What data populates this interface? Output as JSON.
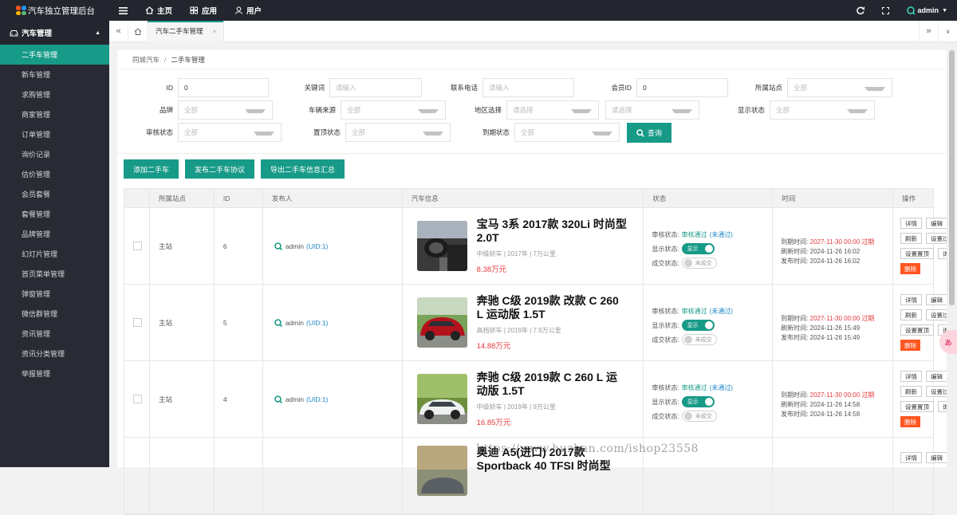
{
  "app": {
    "title": "汽车独立管理后台"
  },
  "topnav": [
    {
      "label": "主页",
      "icon": "home-icon"
    },
    {
      "label": "应用",
      "icon": "apps-icon"
    },
    {
      "label": "用户",
      "icon": "user-icon"
    }
  ],
  "user": {
    "name": "admin"
  },
  "sidebar": {
    "group": "汽车管理",
    "items": [
      {
        "label": "二手车管理"
      },
      {
        "label": "新车管理"
      },
      {
        "label": "求购管理"
      },
      {
        "label": "商家管理"
      },
      {
        "label": "订单管理"
      },
      {
        "label": "询价记录"
      },
      {
        "label": "估价管理"
      },
      {
        "label": "会员套餐"
      },
      {
        "label": "套餐管理"
      },
      {
        "label": "品牌管理"
      },
      {
        "label": "幻灯片管理"
      },
      {
        "label": "首页菜单管理"
      },
      {
        "label": "弹窗管理"
      },
      {
        "label": "微信群管理"
      },
      {
        "label": "资讯管理"
      },
      {
        "label": "资讯分类管理"
      },
      {
        "label": "举报管理"
      }
    ]
  },
  "tab": {
    "label": "汽车二手车管理",
    "close": "×"
  },
  "breadcrumb": {
    "root": "同城汽车",
    "sep": "/",
    "current": "二手车管理"
  },
  "filters": {
    "id": {
      "label": "ID",
      "value": "0"
    },
    "keyword": {
      "label": "关键词",
      "placeholder": "请输入"
    },
    "phone": {
      "label": "联系电话",
      "placeholder": "请输入"
    },
    "member": {
      "label": "会员ID",
      "value": "0"
    },
    "site": {
      "label": "所属站点",
      "value": "全部"
    },
    "brand": {
      "label": "品牌",
      "value": "全部"
    },
    "source": {
      "label": "车辆来源",
      "value": "全部"
    },
    "region": {
      "label": "地区选择",
      "value": "请选择",
      "value2": "请选择"
    },
    "display": {
      "label": "显示状态",
      "value": "全部"
    },
    "audit": {
      "label": "审核状态",
      "value": "全部"
    },
    "top": {
      "label": "置顶状态",
      "value": "全部"
    },
    "expire": {
      "label": "到期状态",
      "value": "全部"
    },
    "query_label": "查询"
  },
  "actions": {
    "add": "添加二手车",
    "agreement": "发布二手车协议",
    "export": "导出二手车信息汇总"
  },
  "table": {
    "headers": [
      "",
      "所属站点",
      "ID",
      "发布人",
      "汽车信息",
      "状态",
      "时间",
      "操作"
    ],
    "status_labels": {
      "audit": "审核状态:",
      "display": "显示状态:",
      "deal": "成交状态:",
      "passed": "审核通过",
      "reject": "(未通过)",
      "show": "显示",
      "not_deal": "未成交"
    },
    "time_labels": {
      "expire": "到期时间:",
      "refresh": "刷新时间:",
      "publish": "发布时间:"
    },
    "op_labels": {
      "detail": "详情",
      "edit": "编辑",
      "refresh": "刷新",
      "set_expire": "设置过期时间",
      "set_top": "设置置顶",
      "inquiry": "询价记录",
      "delete": "删除"
    },
    "rows": [
      {
        "site": "主站",
        "id": "6",
        "publisher": "admin",
        "uid": "(UID:1)",
        "title": "宝马 3系 2017款 320Li 时尚型 2.0T",
        "meta": "中级轿车 | 2017年 | 7万公里",
        "price": "8.38万元",
        "expire": "2027-11-30 00:00 过期",
        "refresh": "2024-11-26 16:02",
        "publish": "2024-11-26 16:02",
        "img": "interior"
      },
      {
        "site": "主站",
        "id": "5",
        "publisher": "admin",
        "uid": "(UID:1)",
        "title": "奔驰 C级 2019款 改款 C 260 L 运动版 1.5T",
        "meta": "高档轿车 | 2019年 | 7.9万公里",
        "price": "14.88万元",
        "expire": "2027-11-30 00:00 过期",
        "refresh": "2024-11-26 15:49",
        "publish": "2024-11-26 15:49",
        "img": "red"
      },
      {
        "site": "主站",
        "id": "4",
        "publisher": "admin",
        "uid": "(UID:1)",
        "title": "奔驰 C级 2019款 C 260 L 运动版 1.5T",
        "meta": "中级轿车 | 2019年 | 9万公里",
        "price": "16.85万元",
        "expire": "2027-11-30 00:00 过期",
        "refresh": "2024-11-26 14:58",
        "publish": "2024-11-26 14:58",
        "img": "white"
      },
      {
        "site": "",
        "id": "",
        "publisher": "",
        "uid": "",
        "title": "奥迪 A5(进口) 2017款 Sportback 40 TFSI 时尚型",
        "meta": "",
        "price": "",
        "expire": "",
        "refresh": "",
        "publish": "",
        "img": "street"
      }
    ]
  },
  "watermark": "https://www.huzhan.com/ishop23558",
  "colors": {
    "primary": "#179a88",
    "danger": "#ff5722",
    "price": "#e4393c",
    "link": "#1e88c8"
  }
}
